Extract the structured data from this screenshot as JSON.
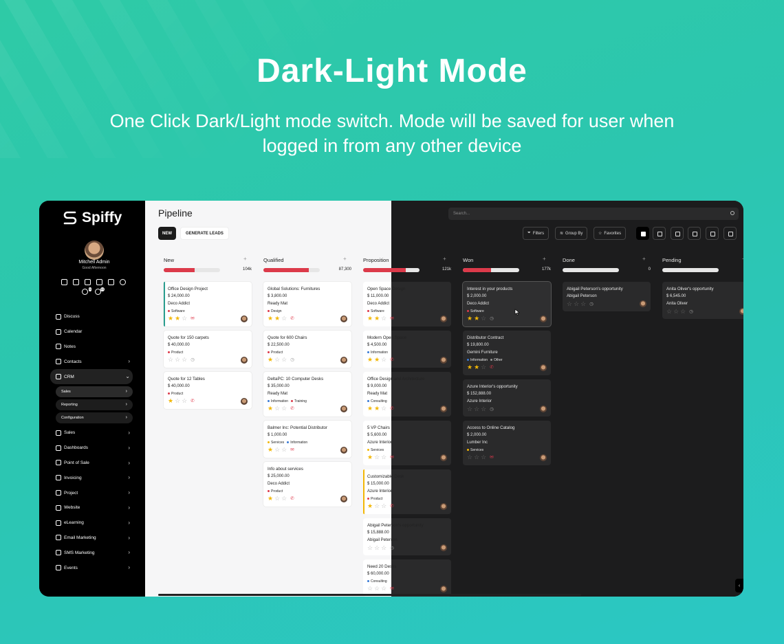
{
  "hero": {
    "title": "Dark-Light Mode",
    "subtitle": "One Click Dark/Light mode switch. Mode will be saved for user when logged in from any other device"
  },
  "app": {
    "brand": "Spiffy",
    "user": {
      "name": "Mitchell Admin",
      "greeting": "Good Afternoon"
    },
    "toolbar_badges": [
      "5",
      "15"
    ],
    "nav": [
      {
        "label": "Discuss",
        "icon": "chat-icon"
      },
      {
        "label": "Calendar",
        "icon": "calendar-icon"
      },
      {
        "label": "Notes",
        "icon": "notes-icon"
      },
      {
        "label": "Contacts",
        "icon": "contacts-icon"
      },
      {
        "label": "CRM",
        "icon": "handshake-icon"
      }
    ],
    "crm_sub": [
      {
        "label": "Sales"
      },
      {
        "label": "Reporting"
      },
      {
        "label": "Configuration"
      }
    ],
    "nav2": [
      {
        "label": "Sales",
        "icon": "chart-icon"
      },
      {
        "label": "Dashboards",
        "icon": "dashboard-icon"
      },
      {
        "label": "Point of Sale",
        "icon": "pos-icon"
      },
      {
        "label": "Invoicing",
        "icon": "invoice-icon"
      },
      {
        "label": "Project",
        "icon": "project-icon"
      },
      {
        "label": "Website",
        "icon": "globe-icon"
      },
      {
        "label": "eLearning",
        "icon": "elearning-icon"
      },
      {
        "label": "Email Marketing",
        "icon": "email-icon"
      },
      {
        "label": "SMS Marketing",
        "icon": "sms-icon"
      },
      {
        "label": "Events",
        "icon": "events-icon"
      }
    ],
    "page_title": "Pipeline",
    "btn_new": "NEW",
    "btn_generate": "GENERATE LEADS",
    "search_placeholder": "Search...",
    "filters": "Filters",
    "group_by": "Group By",
    "favorites": "Favorites"
  },
  "colors": {
    "accent_red": "#dc3a4a",
    "star": "#f2b705",
    "bg_teal": "#2cc6b0"
  },
  "columns": [
    {
      "name": "New",
      "amount": "104k",
      "progress": 0.55,
      "cards": [
        {
          "title": "Office Design Project",
          "amount": "$ 24,000.00",
          "company": "Deco Addict",
          "tags": [
            {
              "t": "Software",
              "c": "#dc3a4a"
            }
          ],
          "stars": 2,
          "act": "mail",
          "edge": "#2a9d8f"
        },
        {
          "title": "Quote for 150 carpets",
          "amount": "$ 40,000.00",
          "company": "",
          "tags": [
            {
              "t": "Product",
              "c": "#dc3a4a"
            }
          ],
          "stars": 0,
          "act": "clock"
        },
        {
          "title": "Quote for 12 Tables",
          "amount": "$ 40,000.00",
          "company": "",
          "tags": [
            {
              "t": "Product",
              "c": "#dc3a4a"
            }
          ],
          "stars": 1,
          "act": "phone"
        }
      ]
    },
    {
      "name": "Qualified",
      "amount": "87,300",
      "progress": 0.8,
      "cards": [
        {
          "title": "Global Solutions: Furnitures",
          "amount": "$ 3,800.00",
          "company": "Ready Mat",
          "tags": [
            {
              "t": "Design",
              "c": "#dc3a4a"
            }
          ],
          "stars": 2,
          "act": "phone"
        },
        {
          "title": "Quote for 600 Chairs",
          "amount": "$ 22,500.00",
          "company": "",
          "tags": [
            {
              "t": "Product",
              "c": "#dc3a4a"
            }
          ],
          "stars": 1,
          "act": "clock"
        },
        {
          "title": "DeltaPC: 10 Computer Desks",
          "amount": "$ 35,000.00",
          "company": "Ready Mat",
          "tags": [
            {
              "t": "Information",
              "c": "#3a7bd5"
            },
            {
              "t": "Training",
              "c": "#dc3a4a"
            }
          ],
          "stars": 1,
          "act": "phone"
        },
        {
          "title": "Balmer Inc: Potential Distributor",
          "amount": "$ 1,000.00",
          "company": "",
          "tags": [
            {
              "t": "Services",
              "c": "#f2b705"
            },
            {
              "t": "Information",
              "c": "#3a7bd5"
            }
          ],
          "stars": 1,
          "act": "mail"
        },
        {
          "title": "Info about services",
          "amount": "$ 25,000.00",
          "company": "Deco Addict",
          "tags": [
            {
              "t": "Product",
              "c": "#dc3a4a"
            }
          ],
          "stars": 1,
          "act": "phone"
        }
      ]
    },
    {
      "name": "Proposition",
      "amount": "121k",
      "progress": 0.75,
      "cards": [
        {
          "title": "Open Space Design",
          "amount": "$ 11,000.00",
          "company": "Deco Addict",
          "tags": [
            {
              "t": "Software",
              "c": "#dc3a4a"
            }
          ],
          "stars": 2,
          "act": "mail"
        },
        {
          "title": "Modern Open Space",
          "amount": "$ 4,500.00",
          "company": "",
          "tags": [
            {
              "t": "Information",
              "c": "#3a7bd5"
            }
          ],
          "stars": 2,
          "act": "phone"
        },
        {
          "title": "Office Design and Architecture",
          "amount": "$ 9,000.00",
          "company": "Ready Mat",
          "tags": [
            {
              "t": "Consulting",
              "c": "#3a7bd5"
            }
          ],
          "stars": 2,
          "act": "phone"
        },
        {
          "title": "5 VP Chairs",
          "amount": "$ 5,600.00",
          "company": "Azure Interior",
          "tags": [
            {
              "t": "Services",
              "c": "#f2b705"
            }
          ],
          "stars": 1,
          "act": "mail"
        },
        {
          "title": "Customizable Desk",
          "amount": "$ 15,000.00",
          "company": "Azure Interior",
          "tags": [
            {
              "t": "Product",
              "c": "#dc3a4a"
            }
          ],
          "stars": 1,
          "act": "phone",
          "edge": "#f2b705"
        },
        {
          "title": "Abigail Peterson's opportunity",
          "amount": "$ 15,888.00",
          "company": "Abigail Peterson",
          "tags": [],
          "stars": 0,
          "act": "clock"
        },
        {
          "title": "Need 20 Desks",
          "amount": "$ 60,000.00",
          "company": "",
          "tags": [
            {
              "t": "Consulting",
              "c": "#3a7bd5"
            }
          ],
          "stars": 0,
          "act": "mail"
        }
      ]
    },
    {
      "name": "Won",
      "amount": "177k",
      "progress": 0.5,
      "cards": [
        {
          "title": "Interest in your products",
          "amount": "$ 2,000.00",
          "company": "Deco Addict",
          "tags": [
            {
              "t": "Software",
              "c": "#dc3a4a"
            }
          ],
          "stars": 2,
          "act": "clock",
          "sel": true
        },
        {
          "title": "Distributor Contract",
          "amount": "$ 19,800.00",
          "company": "Gemini Furniture",
          "tags": [
            {
              "t": "Information",
              "c": "#3a7bd5"
            },
            {
              "t": "Other",
              "c": "#999"
            }
          ],
          "stars": 2,
          "act": "phone"
        },
        {
          "title": "Azure Interior's opportunity",
          "amount": "$ 152,888.00",
          "company": "Azure Interior",
          "tags": [],
          "stars": 0,
          "act": "clock"
        },
        {
          "title": "Access to Online Catalog",
          "amount": "$ 2,000.00",
          "company": "Lumber Inc",
          "tags": [
            {
              "t": "Services",
              "c": "#f2b705"
            }
          ],
          "stars": 0,
          "act": "mail"
        }
      ]
    },
    {
      "name": "Done",
      "amount": "0",
      "progress": 0,
      "cards": [
        {
          "title": "Abigail Peterson's opportunity",
          "amount": "",
          "company": "Abigail Peterson",
          "tags": [],
          "stars": 0,
          "act": "clock"
        }
      ]
    },
    {
      "name": "Pending",
      "amount": "",
      "progress": 0,
      "cards": [
        {
          "title": "Anita Oliver's opportunity",
          "amount": "$ 6,545.00",
          "company": "Anita Oliver",
          "tags": [],
          "stars": 0,
          "act": "clock"
        }
      ]
    }
  ]
}
